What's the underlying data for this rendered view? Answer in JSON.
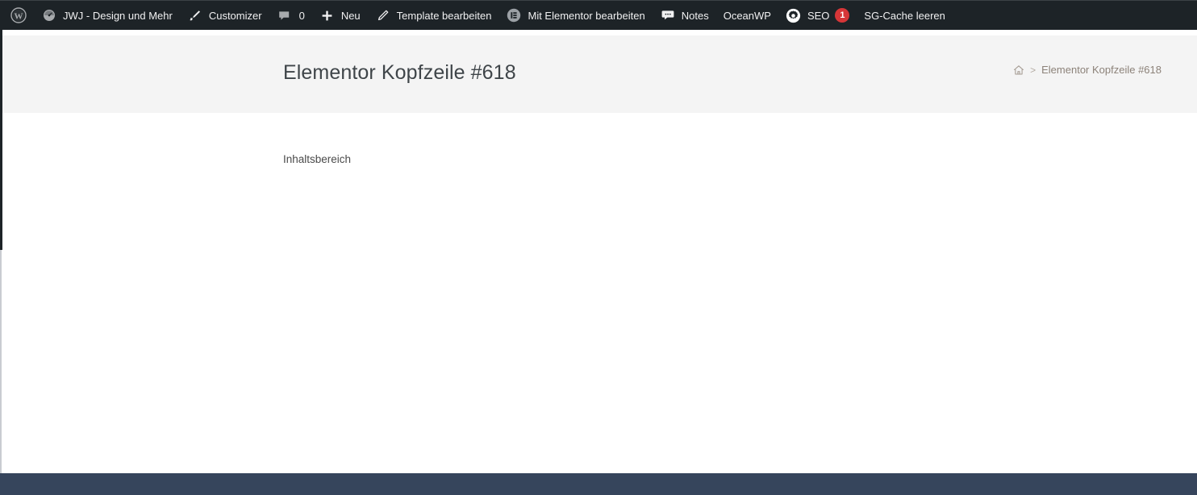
{
  "adminbar": {
    "items": [
      {
        "icon": "wordpress-logo-icon",
        "label": "",
        "name": "adminbar-wp-logo"
      },
      {
        "icon": "dashboard-gauge-icon",
        "label": "JWJ - Design und Mehr",
        "name": "adminbar-site-name"
      },
      {
        "icon": "paintbrush-icon",
        "label": "Customizer",
        "name": "adminbar-customizer"
      },
      {
        "icon": "comment-bubble-icon",
        "label": "0",
        "name": "adminbar-comments"
      },
      {
        "icon": "plus-icon",
        "label": "Neu",
        "name": "adminbar-new"
      },
      {
        "icon": "pencil-icon",
        "label": "Template bearbeiten",
        "name": "adminbar-edit-template"
      },
      {
        "icon": "elementor-icon",
        "label": "Mit Elementor bearbeiten",
        "name": "adminbar-edit-with-elementor"
      },
      {
        "icon": "notes-bubble-icon",
        "label": "Notes",
        "name": "adminbar-notes"
      },
      {
        "icon": "",
        "label": "OceanWP",
        "name": "adminbar-oceanwp"
      },
      {
        "icon": "seo-gear-icon",
        "label": "SEO",
        "badge": "1",
        "name": "adminbar-seo"
      },
      {
        "icon": "",
        "label": "SG-Cache leeren",
        "name": "adminbar-sg-cache"
      }
    ]
  },
  "header": {
    "title": "Elementor Kopfzeile #618",
    "breadcrumb": {
      "home_icon": "home-icon",
      "separator": ">",
      "current": "Elementor Kopfzeile #618"
    }
  },
  "main": {
    "content_text": "Inhaltsbereich"
  },
  "colors": {
    "adminbar_bg": "#1d2327",
    "title_band_bg": "#f4f4f4",
    "footer_bg": "#36455c",
    "badge_red": "#d63638",
    "breadcrumb_text": "#8c8279",
    "title_text": "#3f4549"
  }
}
